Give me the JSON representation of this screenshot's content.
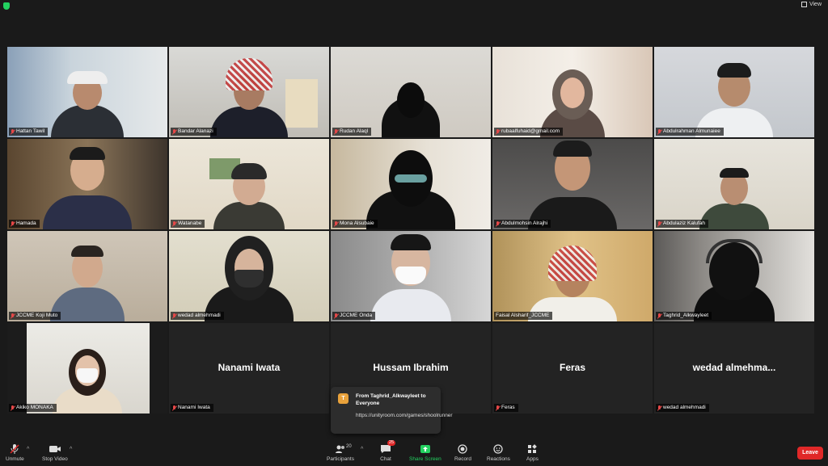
{
  "view": {
    "label": "View"
  },
  "tiles": [
    {
      "name": "Hattan Tawil",
      "muted": true
    },
    {
      "name": "Bandar Alanazi",
      "muted": true
    },
    {
      "name": "Rudan Alaql",
      "muted": true
    },
    {
      "name": "rubaalfuhaid@gmail.com",
      "muted": true
    },
    {
      "name": "Abdulrahman Almunaiee",
      "muted": true
    },
    {
      "name": "Hamada",
      "muted": true
    },
    {
      "name": "Watanabe",
      "muted": true
    },
    {
      "name": "Mona Alsubaie",
      "muted": true
    },
    {
      "name": "Abdulmohsin Alrajhi",
      "muted": true
    },
    {
      "name": "Abdulaziz Kalufah",
      "muted": true
    },
    {
      "name": "JCCME Koji Muto",
      "muted": true
    },
    {
      "name": "wedad almehmadi",
      "muted": true
    },
    {
      "name": "JCCME Onda",
      "muted": true
    },
    {
      "name": "Faisal Alsharif_JCCME",
      "muted": false
    },
    {
      "name": "Taghrid_Alkwayleet",
      "muted": true
    },
    {
      "name": "Akiko MONAKA",
      "muted": true
    },
    {
      "name": "Nanami Iwata",
      "muted": true,
      "display": "Nanami Iwata"
    },
    {
      "name": "Hussam Ibrahim",
      "muted": false,
      "display": "Hussam Ibrahim"
    },
    {
      "name": "Feras",
      "muted": true,
      "display": "Feras"
    },
    {
      "name": "wedad almehmadi",
      "muted": true,
      "display": "wedad  almehma..."
    }
  ],
  "chat_toast": {
    "avatar_letter": "T",
    "title": "From Taghrid_Alkwayleet to Everyone",
    "message": "https://unityroom.com/games/shoolrunner"
  },
  "toolbar": {
    "unmute": "Unmute",
    "stop_video": "Stop Video",
    "participants": "Participants",
    "participants_count": "20",
    "chat": "Chat",
    "chat_badge": "25",
    "share_screen": "Share Screen",
    "record": "Record",
    "reactions": "Reactions",
    "apps": "Apps",
    "leave": "Leave"
  },
  "colors": {
    "accent_green": "#23d160",
    "speaker_outline": "#c6d64a",
    "leave_red": "#e02828"
  }
}
